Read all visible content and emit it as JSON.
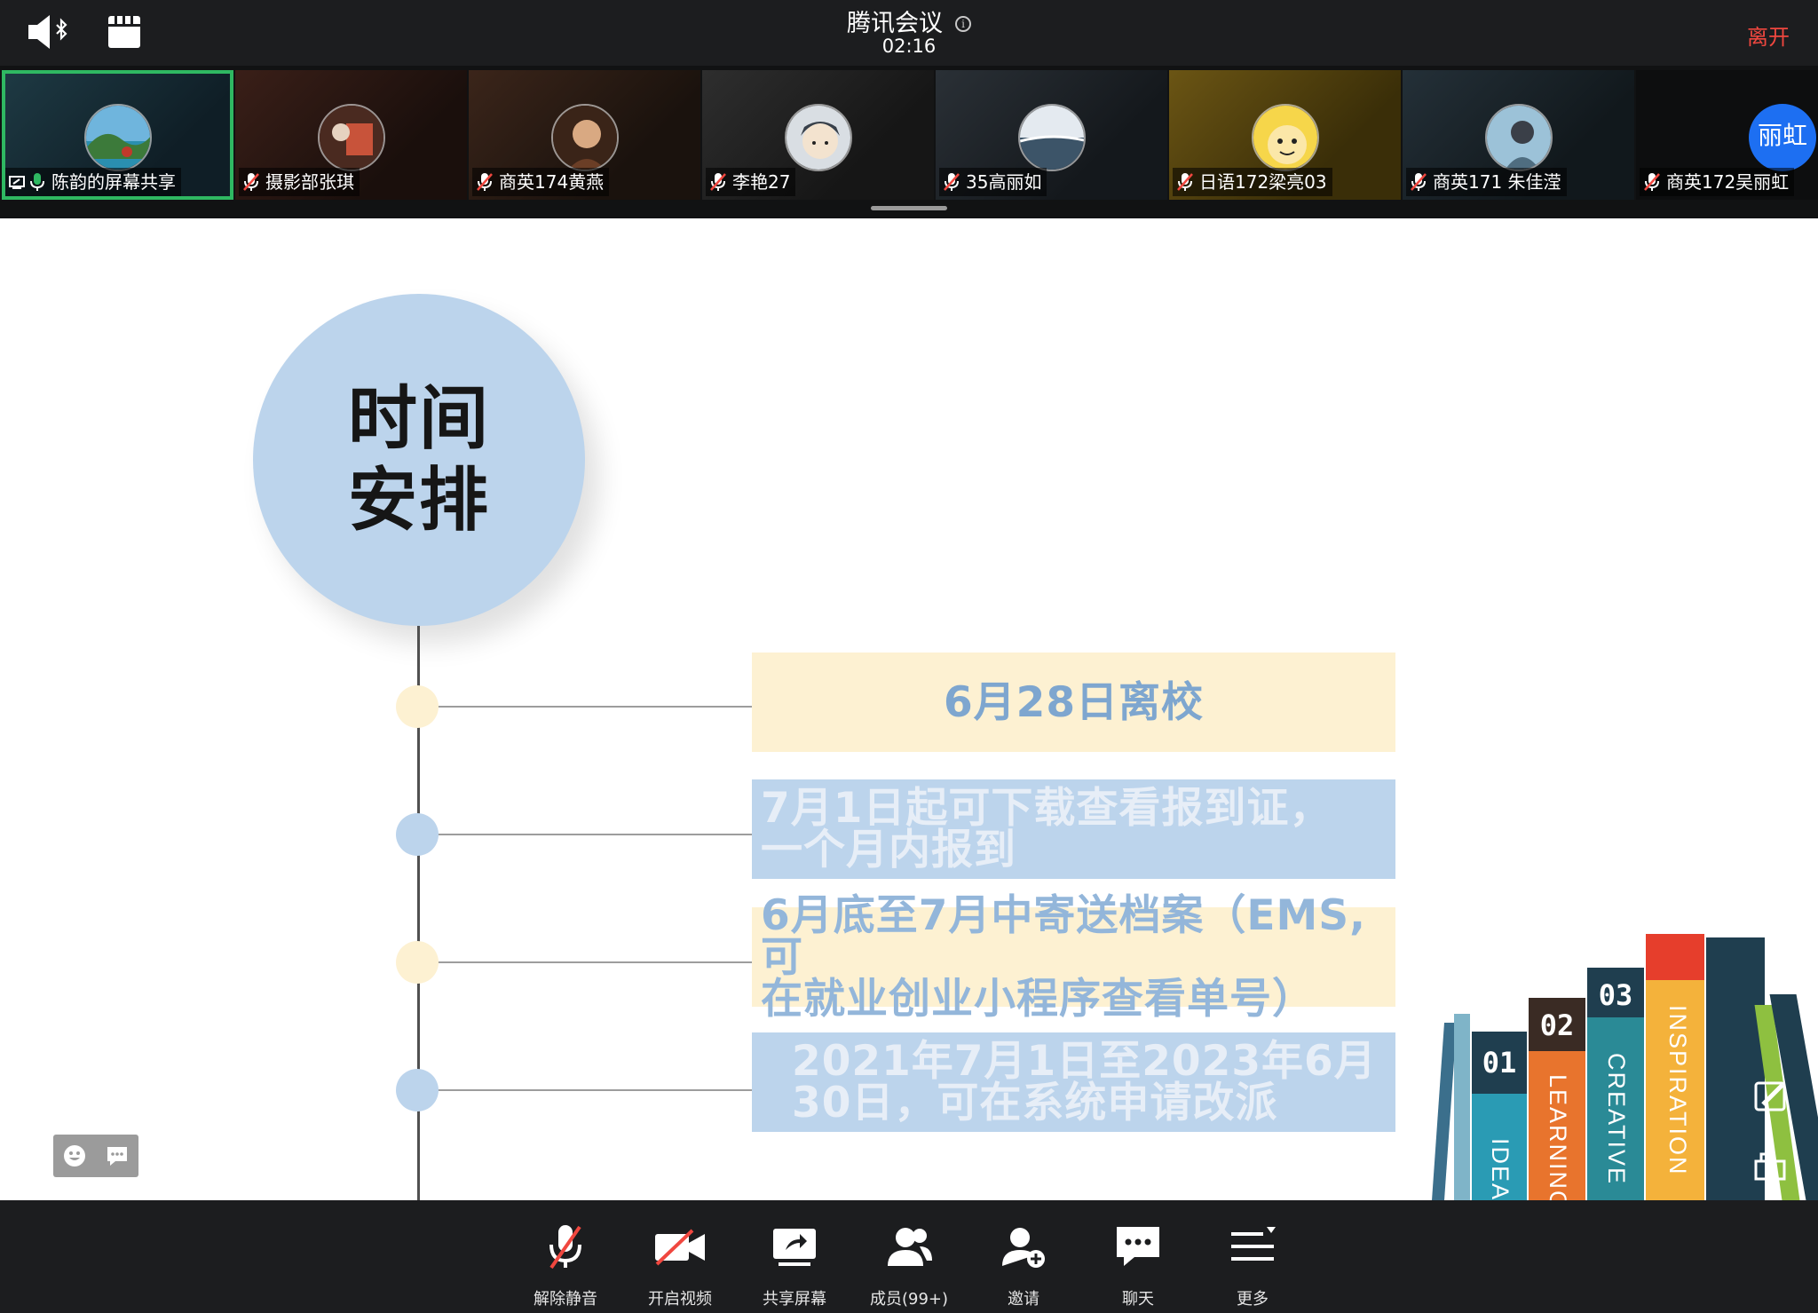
{
  "header": {
    "app_title": "腾讯会议",
    "timer": "02:16",
    "leave_label": "离开"
  },
  "participants": [
    {
      "name": "陈韵的屏幕共享",
      "mic": "on",
      "sharing": true,
      "active": true,
      "avatar": "island-photo"
    },
    {
      "name": "摄影部张琪",
      "mic": "muted",
      "avatar": "room-photo"
    },
    {
      "name": "商英174黄燕",
      "mic": "muted",
      "avatar": "portrait-photo"
    },
    {
      "name": "李艳27",
      "mic": "muted",
      "avatar": "cartoon-girl"
    },
    {
      "name": "35高丽如",
      "mic": "muted",
      "avatar": "sea-photo"
    },
    {
      "name": "日语172梁亮03",
      "mic": "muted",
      "avatar": "cartoon-yellow"
    },
    {
      "name": "商英171 朱佳滢",
      "mic": "muted",
      "avatar": "person-photo"
    },
    {
      "name": "商英172吴丽虹",
      "mic": "muted",
      "avatar_text": "丽虹"
    }
  ],
  "slide": {
    "title_line1": "时间",
    "title_line2": "安排",
    "items": [
      {
        "line1": "6月28日离校",
        "line2": ""
      },
      {
        "line1": "7月1日起可下载查看报到证，",
        "line2": "一个月内报到"
      },
      {
        "line1": "6月底至7月中寄送档案（EMS,可",
        "line2": "在就业创业小程序查看单号）"
      },
      {
        "line1": "2021年7月1日至2023年6月",
        "line2": "30日，可在系统申请改派"
      }
    ],
    "books": [
      {
        "number": "01",
        "spine": "IDEA"
      },
      {
        "number": "02",
        "spine": "LEARNING"
      },
      {
        "number": "03",
        "spine": "CREATIVE"
      },
      {
        "number": "",
        "spine": "INSPIRATION"
      }
    ]
  },
  "toolbar": [
    {
      "label": "解除静音",
      "icon": "mic-muted-icon"
    },
    {
      "label": "开启视频",
      "icon": "video-off-icon"
    },
    {
      "label": "共享屏幕",
      "icon": "share-screen-icon"
    },
    {
      "label": "成员(99+)",
      "icon": "members-icon"
    },
    {
      "label": "邀请",
      "icon": "invite-icon"
    },
    {
      "label": "聊天",
      "icon": "chat-icon"
    },
    {
      "label": "更多",
      "icon": "more-icon"
    }
  ],
  "colors": {
    "active_speaker": "#2fb862",
    "leave": "#f0473f",
    "slide_blue": "#bcd4ec",
    "slide_yellow": "#fdf1d2"
  }
}
